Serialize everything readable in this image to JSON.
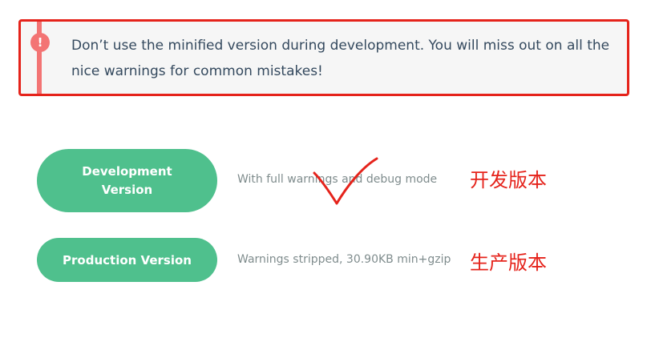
{
  "warning": {
    "icon": "exclamation-icon",
    "icon_glyph": "!",
    "text": "Don’t use the minified version during development. You will miss out on all the nice warnings for common mistakes!",
    "border_color": "#e5231b",
    "accent_color": "#f37474"
  },
  "versions": [
    {
      "button_label": "Development Version",
      "description": "With full warnings and debug mode",
      "annotation": "开发版本"
    },
    {
      "button_label": "Production Version",
      "description": "Warnings stripped, 30.90KB min+gzip",
      "annotation": "生产版本"
    }
  ],
  "annotations": {
    "checkmark_icon": "checkmark-icon",
    "color": "#e5231b"
  },
  "theme": {
    "button_color": "#4fc08d"
  }
}
